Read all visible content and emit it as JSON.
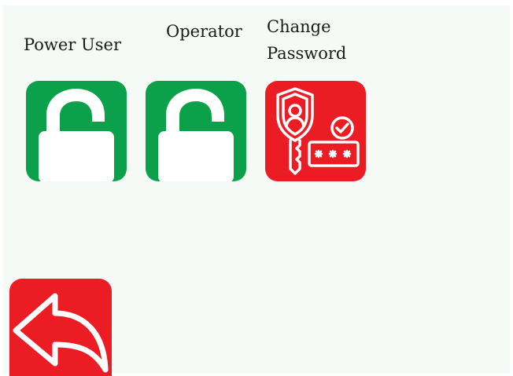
{
  "buttons": {
    "power_user": {
      "label": "Power User",
      "icon": "unlock-icon"
    },
    "operator": {
      "label": "Operator",
      "icon": "unlock-icon"
    },
    "change_password": {
      "label_line1": "Change",
      "label_line2": "Password",
      "icon": "security-key-icon"
    },
    "back": {
      "icon": "back-arrow-icon"
    }
  },
  "colors": {
    "unlock_tile": "#0aa14a",
    "password_tile": "#ec1c24",
    "back_tile": "#ec1c24",
    "background": "#f5faf6"
  }
}
